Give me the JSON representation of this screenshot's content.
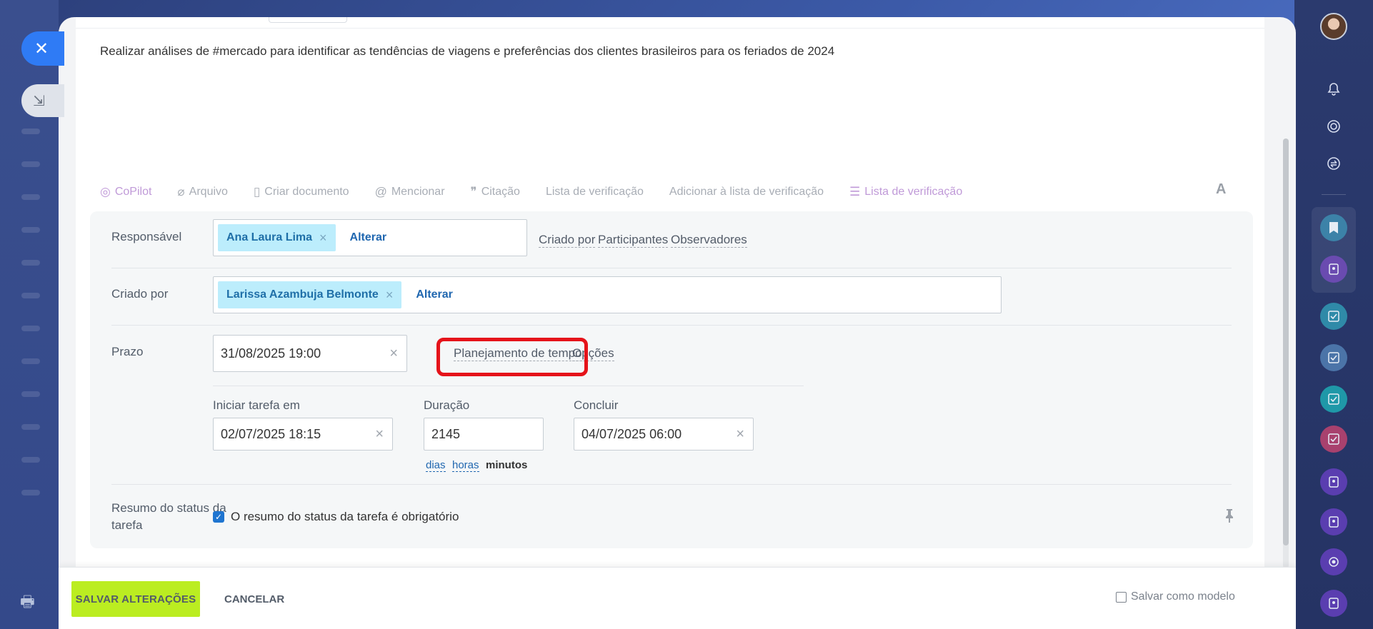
{
  "task": {
    "description": "Realizar análises de #mercado para identificar as tendências de viagens e preferências dos clientes brasileiros para os feriados de 2024"
  },
  "editor_toolbar": {
    "copilot": "CoPilot",
    "file": "Arquivo",
    "create_doc": "Criar documento",
    "mention": "Mencionar",
    "quote": "Citação",
    "checklist": "Lista de verificação",
    "add_to_checklist": "Adicionar à lista de verificação",
    "checklist_active": "Lista de verificação",
    "font": "A"
  },
  "form": {
    "responsible": {
      "label": "Responsável",
      "person": "Ana Laura Lima",
      "change": "Alterar",
      "links": {
        "created_by": "Criado por",
        "participants": "Participantes",
        "observers": "Observadores"
      }
    },
    "created_by": {
      "label": "Criado por",
      "person": "Larissa Azambuja Belmonte",
      "change": "Alterar"
    },
    "deadline": {
      "label": "Prazo",
      "value": "31/08/2025 19:00",
      "time_planning": "Planejamento de tempo",
      "options": "Opções"
    },
    "planning": {
      "start_label": "Iniciar tarefa em",
      "start_value": "02/07/2025 18:15",
      "duration_label": "Duração",
      "duration_value": "2145",
      "end_label": "Concluir",
      "end_value": "04/07/2025 06:00",
      "units": {
        "days": "dias",
        "hours": "horas",
        "minutes": "minutos"
      }
    },
    "status_summary": {
      "label": "Resumo do status da tarefa",
      "checkbox_label": "O resumo do status da tarefa é obrigatório",
      "checked": true
    }
  },
  "footer": {
    "save": "SALVAR ALTERAÇÕES",
    "cancel": "CANCELAR",
    "save_template": "Salvar como modelo"
  },
  "colors": {
    "accent_blue": "#2f7bf5",
    "save_green": "#bbed21",
    "highlight_red": "#e5131a",
    "chip_bg": "#bcedfc"
  }
}
